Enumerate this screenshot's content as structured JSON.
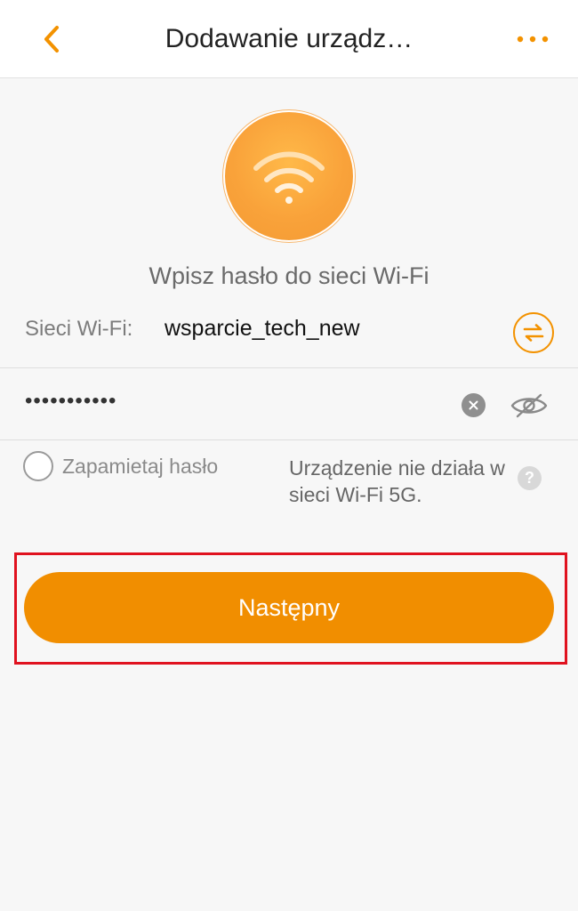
{
  "header": {
    "title": "Dodawanie urządz…",
    "back_icon": "chevron-left-icon",
    "more_icon": "more-dots-icon"
  },
  "hero": {
    "icon": "wifi-icon"
  },
  "form": {
    "prompt": "Wpisz hasło do sieci Wi-Fi",
    "network_label": "Sieci Wi-Fi:",
    "network_name": "wsparcie_tech_new",
    "switch_icon": "swap-arrows-icon",
    "password_value": "•••••••••••",
    "clear_icon": "clear-icon",
    "visibility_icon": "eye-off-icon",
    "remember_label": "Zapamietaj hasło",
    "note": "Urządzenie nie działa w sieci Wi-Fi 5G.",
    "help_label": "?"
  },
  "actions": {
    "next_label": "Następny"
  },
  "colors": {
    "accent": "#f18e00",
    "highlight": "#e0121f"
  }
}
